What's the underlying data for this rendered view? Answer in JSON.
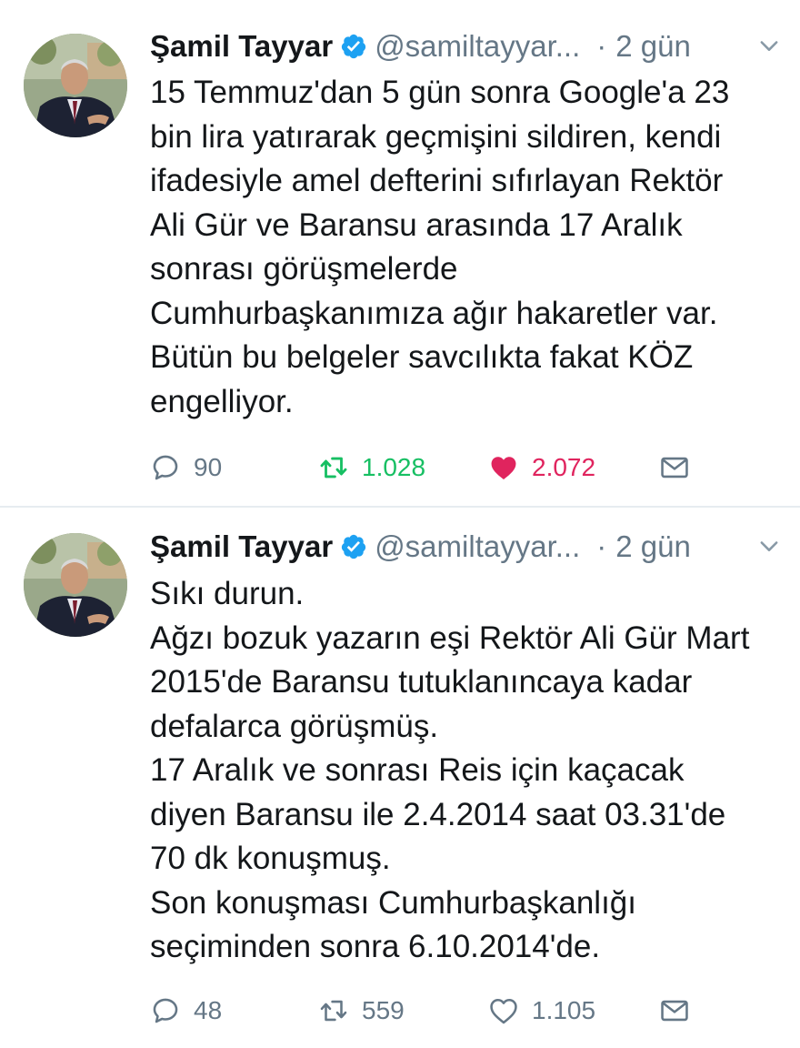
{
  "colors": {
    "text": "#14171a",
    "secondary": "#657786",
    "verified": "#1da1f2",
    "retweet_active": "#17bf63",
    "like_active": "#e0245e",
    "divider": "#e6ecf0"
  },
  "tweets": [
    {
      "name": "Şamil Tayyar",
      "handle": "@samiltayyar...",
      "dot": "·",
      "time": "2 gün",
      "lines": [
        "15 Temmuz'dan 5 gün sonra Google'a 23",
        "bin lira yatırarak geçmişini sildiren, kendi",
        "ifadesiyle amel defterini sıfırlayan Rektör",
        "Ali Gür ve Baransu arasında 17 Aralık",
        "sonrası görüşmelerde",
        "Cumhurbaşkanımıza ağır hakaretler var.",
        "Bütün bu belgeler savcılıkta fakat KÖZ",
        "engelliyor."
      ],
      "replies": "90",
      "retweets": "1.028",
      "likes": "2.072",
      "retweeted": true,
      "liked": true
    },
    {
      "name": "Şamil Tayyar",
      "handle": "@samiltayyar...",
      "dot": "·",
      "time": "2 gün",
      "lines": [
        "Sıkı durun.",
        "Ağzı bozuk yazarın eşi Rektör Ali Gür Mart",
        "2015'de Baransu tutuklanıncaya kadar",
        "defalarca görüşmüş.",
        "17 Aralık ve sonrası Reis için kaçacak",
        "diyen Baransu ile 2.4.2014 saat 03.31'de",
        "70 dk konuşmuş.",
        "Son konuşması Cumhurbaşkanlığı",
        "seçiminden sonra 6.10.2014'de."
      ],
      "replies": "48",
      "retweets": "559",
      "likes": "1.105",
      "retweeted": false,
      "liked": false
    }
  ]
}
